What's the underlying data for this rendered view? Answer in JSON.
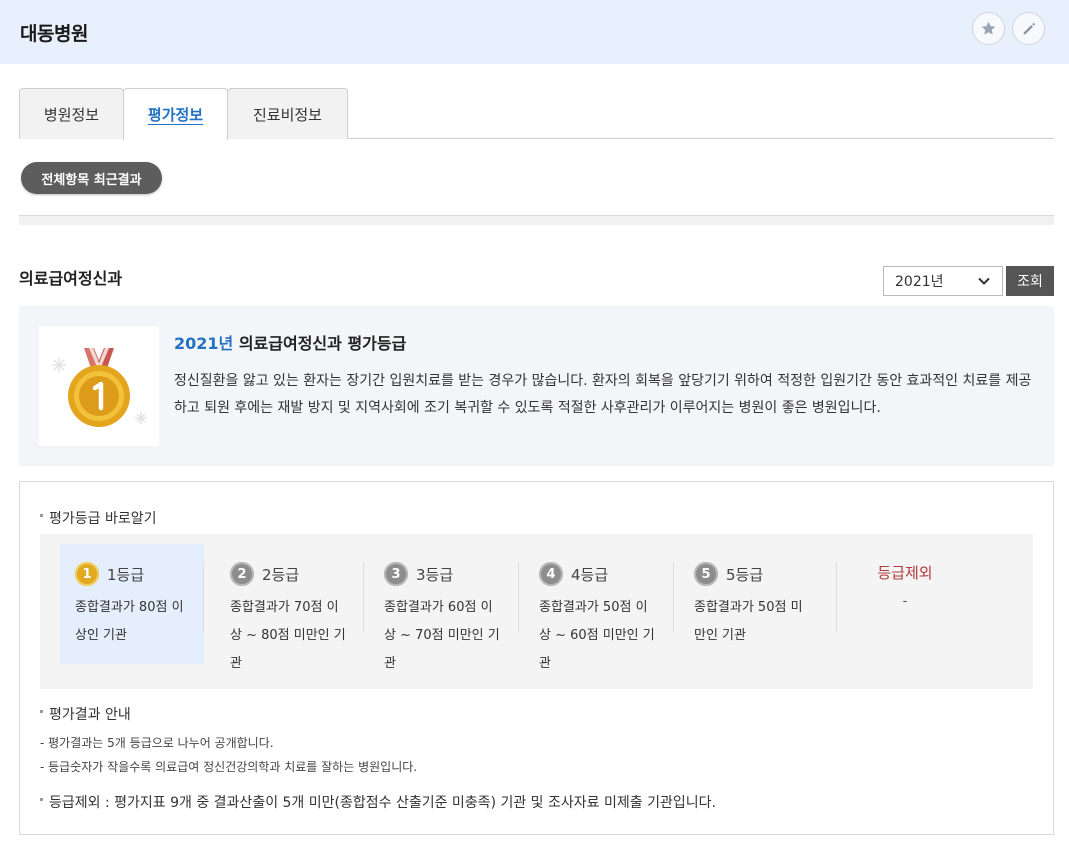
{
  "header": {
    "title": "대동병원"
  },
  "tabs": [
    {
      "label": "병원정보"
    },
    {
      "label": "평가정보"
    },
    {
      "label": "진료비정보"
    }
  ],
  "filter_pill": "전체항목 최근결과",
  "section": {
    "title": "의료급여정신과",
    "year_select": "2021년",
    "search_button": "조회"
  },
  "summary": {
    "year": "2021년",
    "heading": " 의료급여정신과 평가등급",
    "description": "정신질환을 앓고 있는 환자는 장기간 입원치료를 받는 경우가 많습니다. 환자의 회복을 앞당기기 위하여 적정한 입원기간 동안 효과적인 치료를 제공하고 퇴원 후에는 재발 방지 및 지역사회에 조기 복귀할 수 있도록 적절한 사후관리가 이루어지는 병원이 좋은 병원입니다."
  },
  "grade_guide": {
    "title": "평가등급 바로알기",
    "grades": [
      {
        "num": "1",
        "label": "1등급",
        "desc": "종합결과가 80점 이상인 기관"
      },
      {
        "num": "2",
        "label": "2등급",
        "desc": "종합결과가 70점 이상 ~ 80점 미만인 기관"
      },
      {
        "num": "3",
        "label": "3등급",
        "desc": "종합결과가 60점 이상 ~ 70점 미만인 기관"
      },
      {
        "num": "4",
        "label": "4등급",
        "desc": "종합결과가 50점 이상 ~ 60점 미만인 기관"
      },
      {
        "num": "5",
        "label": "5등급",
        "desc": "종합결과가 50점 미만인 기관"
      }
    ],
    "excluded": {
      "label": "등급제외",
      "desc": "-"
    }
  },
  "result_guide": {
    "title": "평가결과 안내",
    "notes": [
      "- 평가결과는 5개 등급으로 나누어 공개합니다.",
      "- 등급숫자가 작을수록 의료급여 정신건강의학과 치료를 잘하는 병원입니다."
    ],
    "exclusion_note": "등급제외 : 평가지표 9개 중 결과산출이 5개 미만(종합점수 산출기준 미충족) 기관 및 조사자료 미제출 기관입니다."
  },
  "colors": {
    "header_bg": "#e8f0fd",
    "accent_blue": "#2271c3",
    "gold": "#e0a91f",
    "excluded_red": "#b23b3b"
  },
  "icons": [
    "star-icon",
    "pencil-icon",
    "chevron-down-icon",
    "medal-icon"
  ]
}
